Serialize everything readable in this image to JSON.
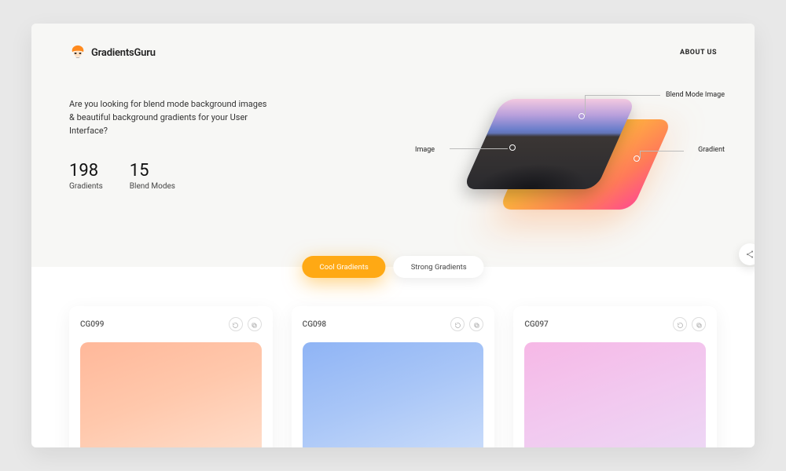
{
  "brand": {
    "name": "GradientsGuru"
  },
  "nav": {
    "about": "ABOUT US"
  },
  "hero": {
    "tagline": "Are you looking for blend mode background images & beautiful background gradients for your User Interface?",
    "stats": [
      {
        "value": "198",
        "label": "Gradients"
      },
      {
        "value": "15",
        "label": "Blend Modes"
      }
    ],
    "labels": {
      "image": "Image",
      "blend": "Blend Mode Image",
      "gradient": "Gradient"
    }
  },
  "tabs": {
    "cool": "Cool Gradients",
    "strong": "Strong Gradients"
  },
  "cards": [
    {
      "id": "CG099"
    },
    {
      "id": "CG098"
    },
    {
      "id": "CG097"
    }
  ]
}
